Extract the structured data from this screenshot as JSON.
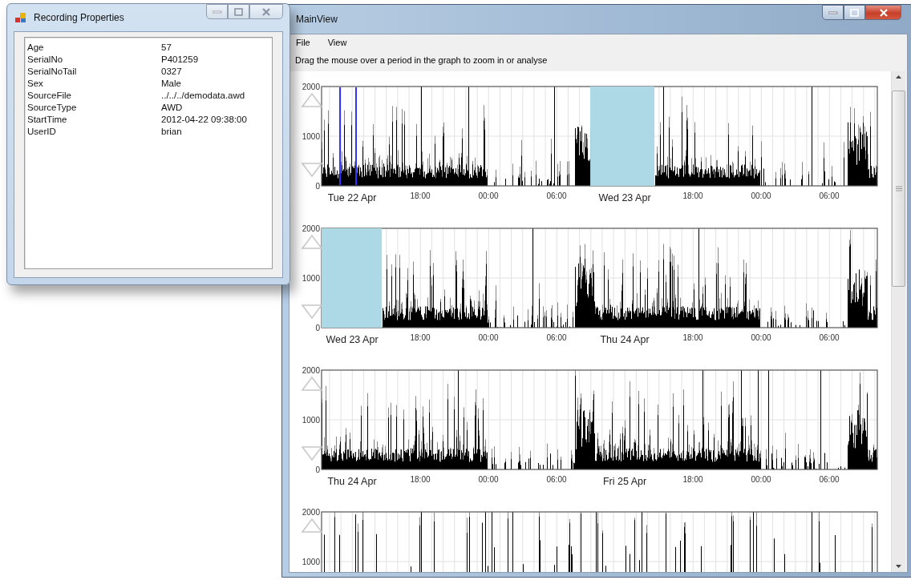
{
  "properties_window": {
    "title": "Recording Properties",
    "rows": [
      {
        "key": "Age",
        "value": "57"
      },
      {
        "key": "SerialNo",
        "value": "P401259"
      },
      {
        "key": "SerialNoTail",
        "value": "0327"
      },
      {
        "key": "Sex",
        "value": "Male"
      },
      {
        "key": "SourceFile",
        "value": "../../../demodata.awd"
      },
      {
        "key": "SourceType",
        "value": "AWD"
      },
      {
        "key": "StartTime",
        "value": "2012-04-22 09:38:00"
      },
      {
        "key": "UserID",
        "value": "brian"
      }
    ]
  },
  "main_window": {
    "title": "MainView",
    "menu": [
      "File",
      "View"
    ],
    "instruction": "Drag the mouse over a period in the graph to zoom in or analyse",
    "graphs": [
      {
        "y_labels": [
          "2000",
          "1000",
          "0"
        ],
        "x_labels": [
          {
            "text": "Tue 22 Apr",
            "kind": "day"
          },
          {
            "text": "18:00",
            "kind": "time"
          },
          {
            "text": "00:00",
            "kind": "time"
          },
          {
            "text": "06:00",
            "kind": "time"
          },
          {
            "text": "Wed 23 Apr",
            "kind": "day"
          },
          {
            "text": "18:00",
            "kind": "time"
          },
          {
            "text": "00:00",
            "kind": "time"
          },
          {
            "text": "06:00",
            "kind": "time"
          }
        ],
        "highlight": true,
        "cursor_lines": true
      },
      {
        "y_labels": [
          "2000",
          "1000",
          "0"
        ],
        "x_labels": [
          {
            "text": "Wed 23 Apr",
            "kind": "day"
          },
          {
            "text": "18:00",
            "kind": "time"
          },
          {
            "text": "00:00",
            "kind": "time"
          },
          {
            "text": "06:00",
            "kind": "time"
          },
          {
            "text": "Thu 24 Apr",
            "kind": "day"
          },
          {
            "text": "18:00",
            "kind": "time"
          },
          {
            "text": "00:00",
            "kind": "time"
          },
          {
            "text": "06:00",
            "kind": "time"
          }
        ],
        "highlight": true,
        "cursor_lines": false
      },
      {
        "y_labels": [
          "2000",
          "1000",
          "0"
        ],
        "x_labels": [
          {
            "text": "Thu 24 Apr",
            "kind": "day"
          },
          {
            "text": "18:00",
            "kind": "time"
          },
          {
            "text": "00:00",
            "kind": "time"
          },
          {
            "text": "06:00",
            "kind": "time"
          },
          {
            "text": "Fri 25 Apr",
            "kind": "day"
          },
          {
            "text": "18:00",
            "kind": "time"
          },
          {
            "text": "00:00",
            "kind": "time"
          },
          {
            "text": "06:00",
            "kind": "time"
          }
        ],
        "highlight": false,
        "cursor_lines": false
      },
      {
        "y_labels": [
          "2000",
          "1000"
        ],
        "highlight": false,
        "cursor_lines": false
      }
    ]
  }
}
